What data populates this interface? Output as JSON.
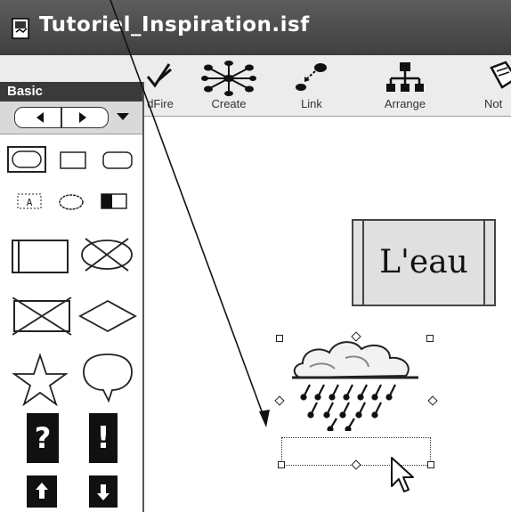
{
  "window": {
    "title": "Tutoriel_Inspiration.isf"
  },
  "toolbar": {
    "buttons": [
      {
        "label": "dFire",
        "icon": "rapidfire-icon"
      },
      {
        "label": "Create",
        "icon": "create-icon"
      },
      {
        "label": "Link",
        "icon": "link-icon"
      },
      {
        "label": "Arrange",
        "icon": "arrange-icon"
      },
      {
        "label": "Not",
        "icon": "note-icon"
      }
    ]
  },
  "palette": {
    "title": "Basic",
    "nav": [
      "prev-arrow-icon",
      "next-arrow-icon",
      "dropdown-icon"
    ],
    "symbols": [
      "rounded-oval",
      "rectangle",
      "rounded-rect",
      "dotted-label",
      "cloud-oval",
      "half-filled-rect",
      "double-rect",
      "crossed-oval",
      "crossed-rect",
      "diamond",
      "star",
      "speech-bubble",
      "question-mark",
      "exclamation-mark",
      "up-arrow",
      "down-arrow"
    ],
    "question_glyph": "?",
    "exclamation_glyph": "!"
  },
  "canvas": {
    "topic_label": "L'eau",
    "selected_symbol": "rain-cloud-icon",
    "text_field_value": ""
  },
  "colors": {
    "titlebar": "#4a4a4a",
    "palette_header": "#3a3a3a"
  }
}
